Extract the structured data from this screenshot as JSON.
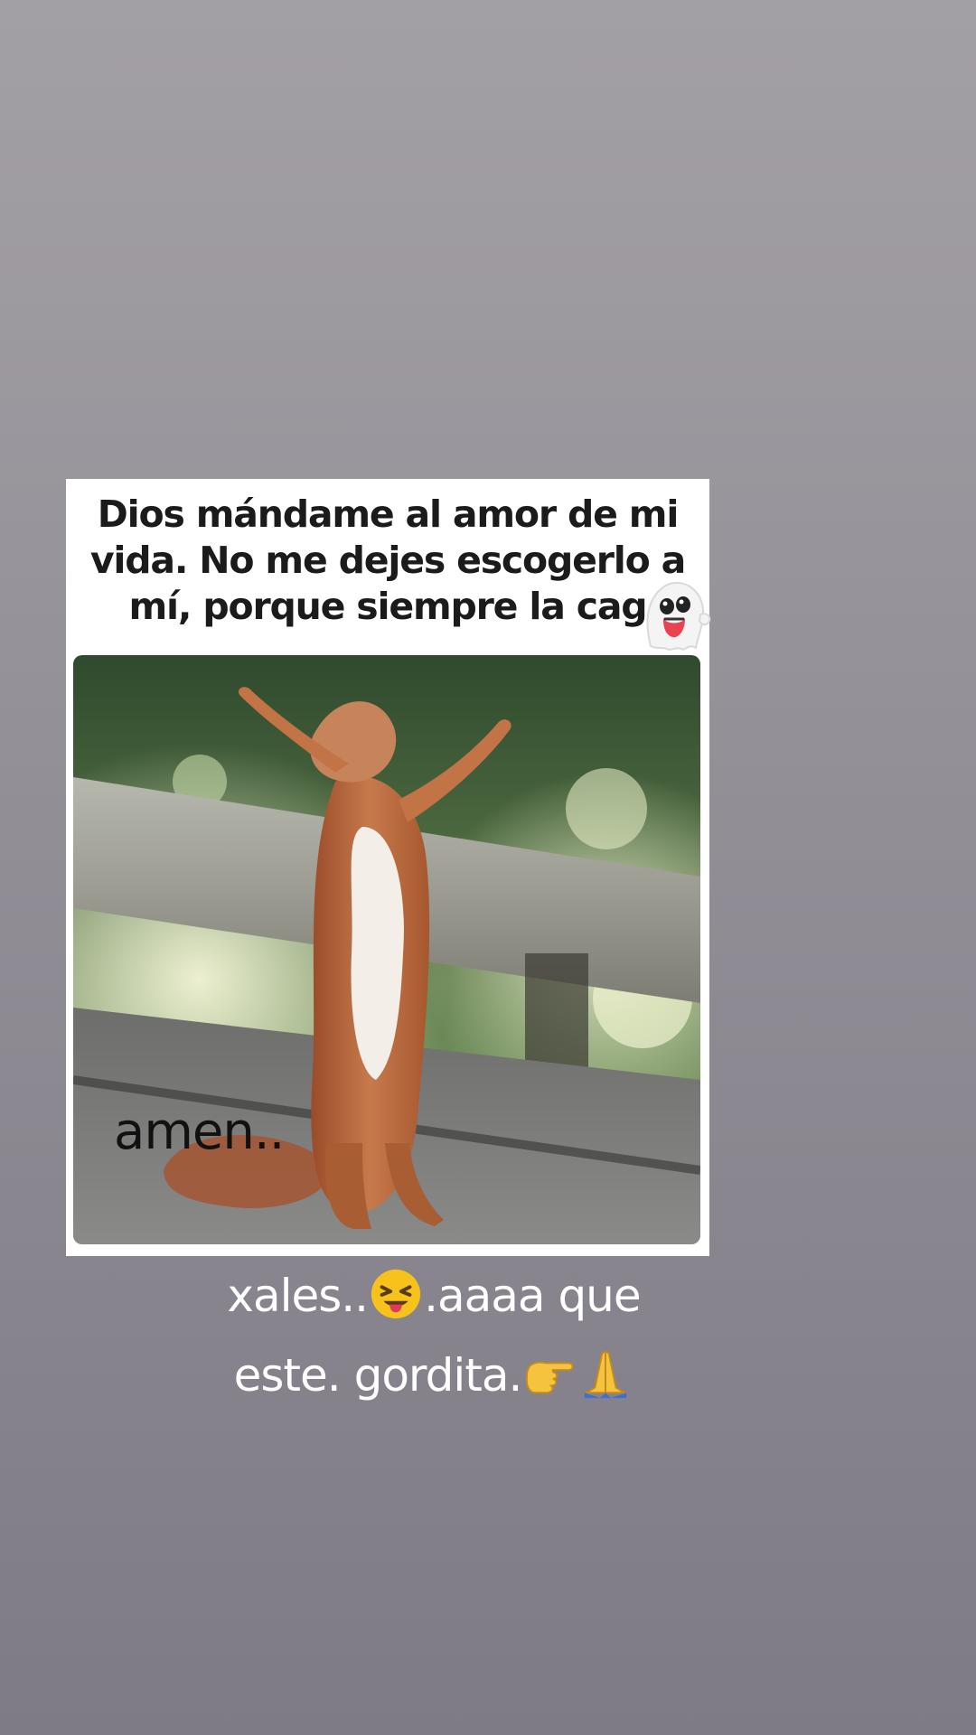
{
  "meme": {
    "caption": "Dios mándame al amor de mi\nvida. No me dejes escogerlo a\nmí, porque siempre la cag",
    "overlay_text": "amen..",
    "ghost_sticker_icon": "ghost-tongue-emoji"
  },
  "story_caption": {
    "line1_a": "xales..",
    "line1_emoji": "squinting-face-with-tongue-emoji",
    "line1_b": ".aaaa que",
    "line2_a": "este. gordita.",
    "line2_emoji1": "backhand-index-pointing-right-emoji",
    "line2_emoji2": "folded-hands-emoji"
  },
  "colors": {
    "background_top": "#a3a0a5",
    "background_bottom": "#7f7b86",
    "caption_text": "#ffffff",
    "meme_text": "#1b1b1b"
  }
}
